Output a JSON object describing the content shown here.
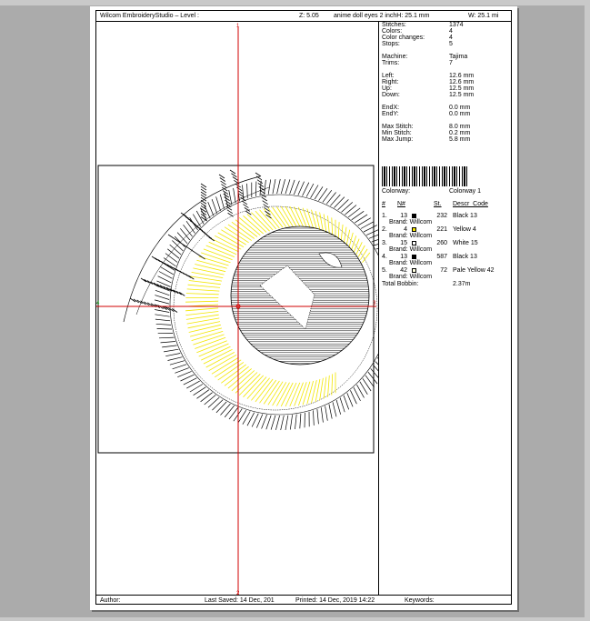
{
  "header": {
    "title": "Wilcom EmbroideryStudio – Level :",
    "zoom": "Z: 5.05",
    "design": "anime doll eyes 2 inchH: 25.1 mm",
    "width": "W: 25.1 mi"
  },
  "canvas": {
    "axis_top": "1",
    "axis_bottom": "2",
    "axis_left": "4",
    "axis_right": "3"
  },
  "stats": [
    {
      "label": "Stitches:",
      "value": "1374"
    },
    {
      "label": "Colors:",
      "value": "4"
    },
    {
      "label": "Color changes:",
      "value": "4"
    },
    {
      "label": "Stops:",
      "value": "5"
    },
    {
      "label": "Machine:",
      "value": "Tajima"
    },
    {
      "label": "Trims:",
      "value": "7"
    },
    {
      "label": "Left:",
      "value": "12.6 mm"
    },
    {
      "label": "Right:",
      "value": "12.6 mm"
    },
    {
      "label": "Up:",
      "value": "12.5 mm"
    },
    {
      "label": "Down:",
      "value": "12.5 mm"
    },
    {
      "label": "EndX:",
      "value": "0.0 mm"
    },
    {
      "label": "EndY:",
      "value": "0.0 mm"
    },
    {
      "label": "Max Stitch:",
      "value": "8.0 mm"
    },
    {
      "label": "Min Stitch:",
      "value": "0.2 mm"
    },
    {
      "label": "Max Jump:",
      "value": "5.8 mm"
    }
  ],
  "colorway": {
    "label": "Colorway:",
    "value": "Colorway 1"
  },
  "table_headers": {
    "num": "#",
    "n": "N#",
    "st": "St.",
    "desc": "Descr_Code"
  },
  "colors": [
    {
      "num": "1.",
      "n": "13",
      "st": "232",
      "desc": "Black 13",
      "brand": "Brand: Willcom",
      "color": "#000000"
    },
    {
      "num": "2.",
      "n": "4",
      "st": "221",
      "desc": "Yellow 4",
      "brand": "Brand: Willcom",
      "color": "#f5e400"
    },
    {
      "num": "3.",
      "n": "15",
      "st": "260",
      "desc": "White 15",
      "brand": "Brand: Willcom",
      "color": "#ffffff"
    },
    {
      "num": "4.",
      "n": "13",
      "st": "587",
      "desc": "Black 13",
      "brand": "Brand: Willcom",
      "color": "#000000"
    },
    {
      "num": "5.",
      "n": "42",
      "st": "72",
      "desc": "Pale Yellow 42",
      "brand": "Brand: Willcom",
      "color": "#ffffe0"
    }
  ],
  "bobbin": {
    "label": "Total Bobbin:",
    "value": "2.37m"
  },
  "footer": {
    "author": "Author:",
    "saved": "Last Saved: 14 Dec, 201",
    "printed": "Printed: 14 Dec, 2019 14:22",
    "keywords": "Keywords:"
  }
}
